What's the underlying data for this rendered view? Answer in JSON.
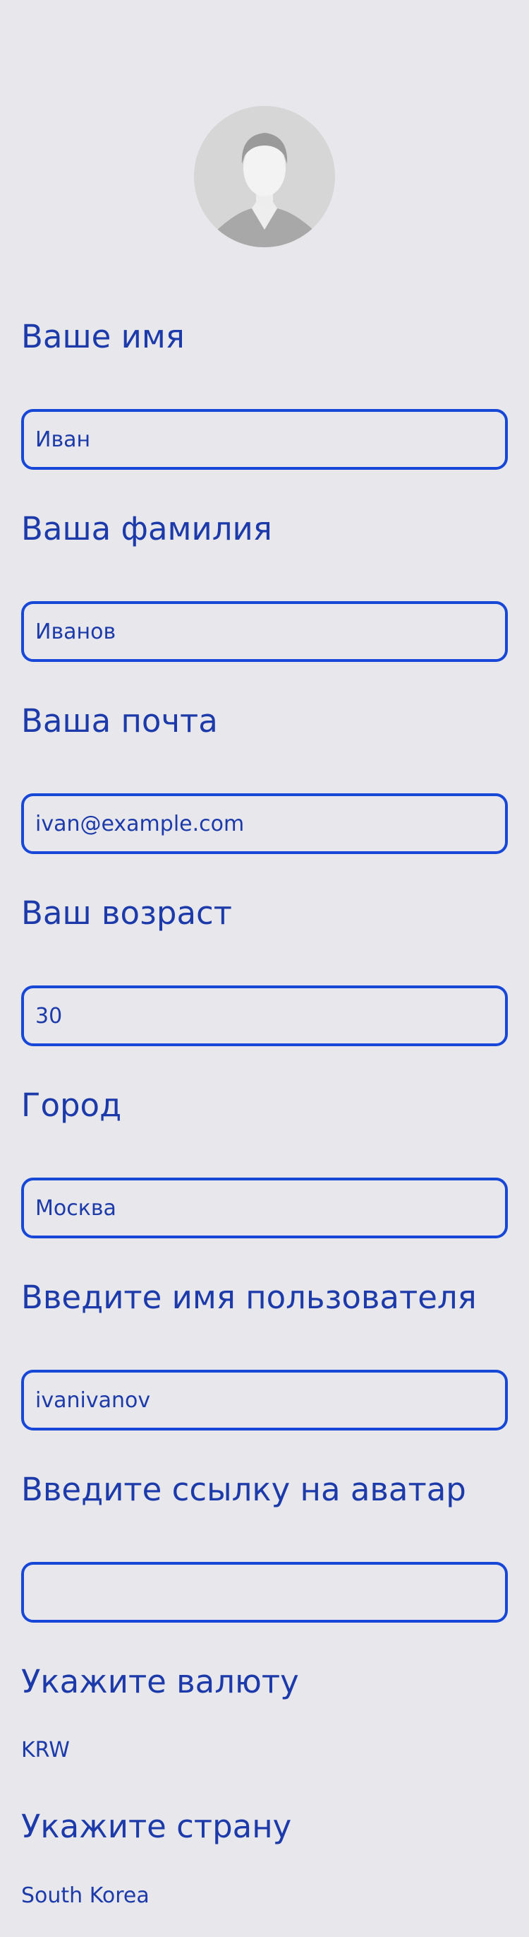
{
  "profile": {
    "avatar_icon": "person-silhouette-icon",
    "fields": [
      {
        "label": "Ваше имя",
        "value": "Иван"
      },
      {
        "label": "Ваша фамилия",
        "value": "Иванов"
      },
      {
        "label": "Ваша почта",
        "value": "ivan@example.com"
      },
      {
        "label": "Ваш возраст",
        "value": "30"
      },
      {
        "label": "Город",
        "value": "Москва"
      },
      {
        "label": "Введите имя пользователя",
        "value": "ivanivanov"
      },
      {
        "label": "Введите ссылку на аватар",
        "value": ""
      }
    ],
    "currency": {
      "label": "Укажите валюту",
      "value": "KRW"
    },
    "country": {
      "label": "Укажите страну",
      "value": "South Korea"
    }
  },
  "colors": {
    "background": "#e8e8ec",
    "text": "#1c3aa9",
    "border": "#1747d6"
  }
}
